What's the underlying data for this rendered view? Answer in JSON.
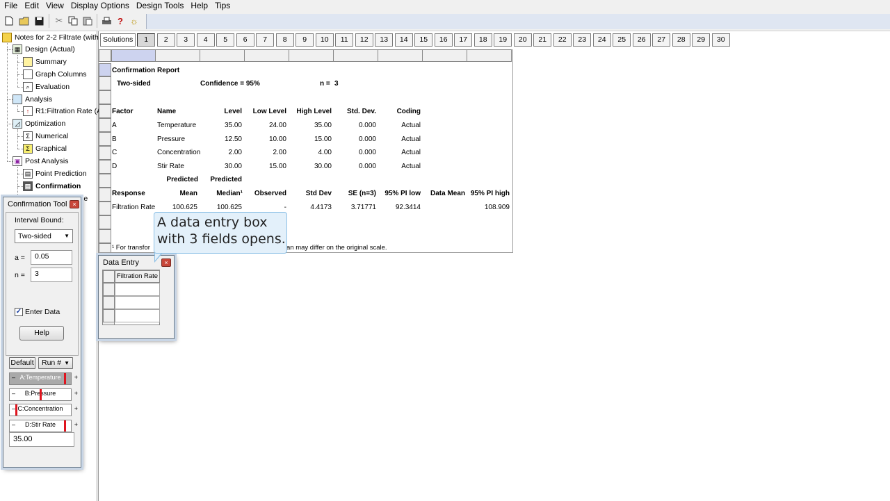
{
  "menu": [
    "File",
    "Edit",
    "View",
    "Display Options",
    "Design Tools",
    "Help",
    "Tips"
  ],
  "toolbar_icons": [
    "new-file-icon",
    "open-folder-icon",
    "save-icon",
    "cut-icon",
    "copy-icon",
    "paste-icon",
    "print-icon",
    "help-question-icon",
    "tip-lightbulb-icon"
  ],
  "tree": {
    "root": "Notes for 2-2 Filtrate (with",
    "items": [
      {
        "label": "Design (Actual)",
        "level": 1
      },
      {
        "label": "Summary",
        "level": 2
      },
      {
        "label": "Graph Columns",
        "level": 2
      },
      {
        "label": "Evaluation",
        "level": 2
      },
      {
        "label": "Analysis",
        "level": 1
      },
      {
        "label": "R1:Filtration Rate (A",
        "level": 2
      },
      {
        "label": "Optimization",
        "level": 1
      },
      {
        "label": "Numerical",
        "level": 2
      },
      {
        "label": "Graphical",
        "level": 2
      },
      {
        "label": "Post Analysis",
        "level": 1
      },
      {
        "label": "Point Prediction",
        "level": 2
      },
      {
        "label": "Confirmation",
        "level": 2
      },
      {
        "label": "le",
        "level": 2
      }
    ]
  },
  "solutions": {
    "label": "Solutions",
    "numbers": [
      "1",
      "2",
      "3",
      "4",
      "5",
      "6",
      "7",
      "8",
      "9",
      "10",
      "11",
      "12",
      "13",
      "14",
      "15",
      "16",
      "17",
      "18",
      "19",
      "20",
      "21",
      "22",
      "23",
      "24",
      "25",
      "26",
      "27",
      "28",
      "29",
      "30"
    ],
    "active": "1"
  },
  "report": {
    "title": "Confirmation Report",
    "sided": "Two-sided",
    "confidence": "Confidence = 95%",
    "n_label": "n =",
    "n_value": "3",
    "factor_headers": [
      "Factor",
      "Name",
      "Level",
      "Low Level",
      "High Level",
      "Std. Dev.",
      "Coding"
    ],
    "factors": [
      [
        "A",
        "Temperature",
        "35.00",
        "24.00",
        "35.00",
        "0.000",
        "Actual"
      ],
      [
        "B",
        "Pressure",
        "12.50",
        "10.00",
        "15.00",
        "0.000",
        "Actual"
      ],
      [
        "C",
        "Concentration",
        "2.00",
        "2.00",
        "4.00",
        "0.000",
        "Actual"
      ],
      [
        "D",
        "Stir Rate",
        "30.00",
        "15.00",
        "30.00",
        "0.000",
        "Actual"
      ]
    ],
    "pred_header_top": [
      "Predicted",
      "Predicted"
    ],
    "response_headers": [
      "Response",
      "Mean",
      "Median¹",
      "Observed",
      "Std Dev",
      "SE (n=3)",
      "95% PI low",
      "Data Mean",
      "95% PI high"
    ],
    "response_row": [
      "Filtration Rate",
      "100.625",
      "100.625",
      "-",
      "4.4173",
      "3.71771",
      "92.3414",
      "",
      "108.909"
    ],
    "footnote_start": "¹ For transfor",
    "footnote_end": "an may differ on the original scale."
  },
  "confirmation_tool": {
    "title": "Confirmation Tool",
    "interval_label": "Interval Bound:",
    "interval_value": "Two-sided",
    "alpha_label": "a =",
    "alpha_value": "0.05",
    "n_label": "n =",
    "n_value": "3",
    "enter_data_label": "Enter Data",
    "enter_data_checked": true,
    "help_label": "Help",
    "default_label": "Default",
    "run_label": "Run #",
    "sliders": [
      {
        "label": "A:Temperature",
        "level": 1.0
      },
      {
        "label": "B:Pressure",
        "level": 0.5
      },
      {
        "label": "C:Concentration",
        "level": 0.0
      },
      {
        "label": "D:Stir Rate",
        "level": 1.0
      }
    ],
    "value_display": "35.00"
  },
  "data_entry": {
    "title": "Data Entry",
    "column": "Filtration Rate",
    "rows": [
      "",
      "",
      ""
    ]
  },
  "callout": {
    "line1": "A data entry box",
    "line2": "with 3 fields opens."
  }
}
